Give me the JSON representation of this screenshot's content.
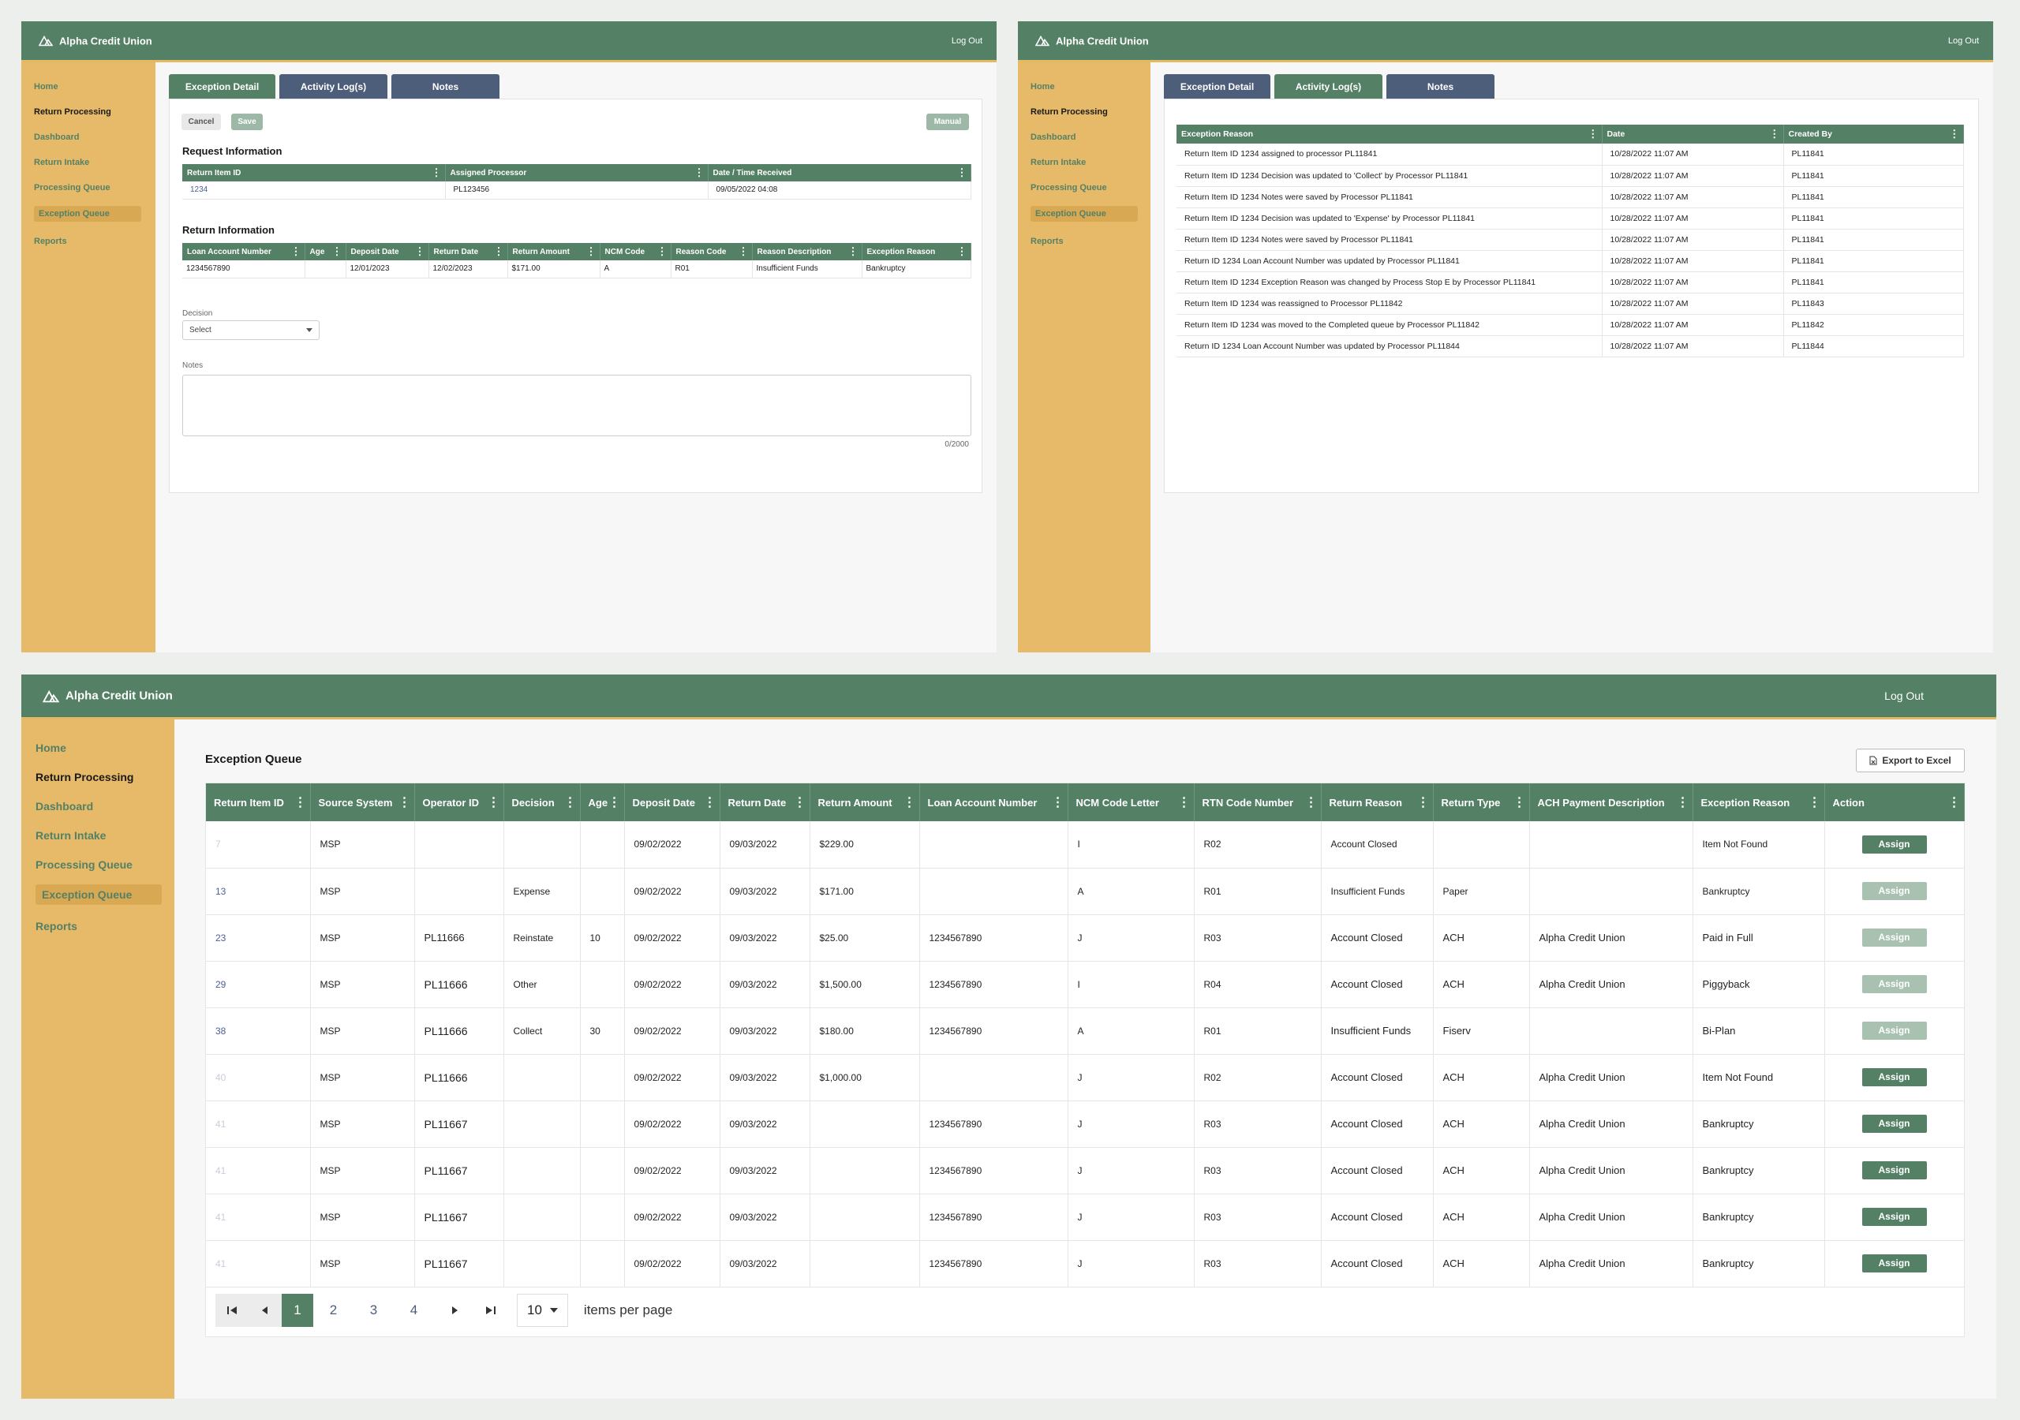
{
  "app": {
    "brand": "Alpha Credit Union",
    "logout": "Log Out"
  },
  "nav": [
    {
      "label": "Home"
    },
    {
      "label": "Return Processing"
    },
    {
      "label": "Dashboard"
    },
    {
      "label": "Return Intake"
    },
    {
      "label": "Processing Queue"
    },
    {
      "label": "Exception Queue"
    },
    {
      "label": "Reports"
    }
  ],
  "tabs": [
    "Exception Detail",
    "Activity Log(s)",
    "Notes"
  ],
  "detail": {
    "cancel": "Cancel",
    "save": "Save",
    "manual": "Manual",
    "request_title": "Request Information",
    "request_headers": [
      "Return Item ID",
      "Assigned Processor",
      "Date / Time Received"
    ],
    "request_row": [
      "1234",
      "PL123456",
      "09/05/2022 04:08"
    ],
    "return_title": "Return Information",
    "return_headers": [
      "Loan Account Number",
      "Age",
      "Deposit Date",
      "Return Date",
      "Return Amount",
      "NCM Code",
      "Reason Code",
      "Reason Description",
      "Exception Reason"
    ],
    "return_row": [
      "1234567890",
      "",
      "12/01/2023",
      "12/02/2023",
      "$171.00",
      "A",
      "R01",
      "Insufficient Funds",
      "Bankruptcy"
    ],
    "decision_label": "Decision",
    "decision_value": "Select",
    "notes_label": "Notes",
    "notes_count": "0/2000"
  },
  "activity": {
    "headers": [
      "Exception Reason",
      "Date",
      "Created By"
    ],
    "rows": [
      [
        "Return Item ID 1234 assigned to processor PL11841",
        "10/28/2022 11:07 AM",
        "PL11841"
      ],
      [
        "Return Item ID 1234 Decision was updated to 'Collect' by Processor PL11841",
        "10/28/2022 11:07 AM",
        "PL11841"
      ],
      [
        "Return Item ID 1234 Notes were saved by Processor PL11841",
        "10/28/2022 11:07 AM",
        "PL11841"
      ],
      [
        "Return Item ID 1234 Decision was updated to 'Expense' by Processor PL11841",
        "10/28/2022 11:07 AM",
        "PL11841"
      ],
      [
        "Return Item ID 1234 Notes were saved by Processor PL11841",
        "10/28/2022 11:07 AM",
        "PL11841"
      ],
      [
        "Return ID 1234 Loan Account Number was updated by Processor PL11841",
        "10/28/2022 11:07 AM",
        "PL11841"
      ],
      [
        "Return Item ID 1234 Exception Reason was changed by Process Stop E by Processor PL11841",
        "10/28/2022 11:07 AM",
        "PL11841"
      ],
      [
        "Return Item ID 1234 was reassigned to Processor PL11842",
        "10/28/2022 11:07 AM",
        "PL11843"
      ],
      [
        "Return Item ID 1234 was moved to the Completed queue by Processor PL11842",
        "10/28/2022 11:07 AM",
        "PL11842"
      ],
      [
        "Return ID 1234 Loan Account Number was updated by Processor PL11844",
        "10/28/2022 11:07 AM",
        "PL11844"
      ]
    ]
  },
  "queue": {
    "title": "Exception Queue",
    "export": "Export to Excel",
    "headers": [
      "Return Item ID",
      "Source System",
      "Operator ID",
      "Decision",
      "Age",
      "Deposit Date",
      "Return Date",
      "Return Amount",
      "Loan Account Number",
      "NCM Code Letter",
      "RTN Code Number",
      "Return Reason",
      "Return Type",
      "ACH Payment Description",
      "Exception Reason",
      "Action"
    ],
    "rows": [
      [
        "7",
        "MSP",
        "",
        "",
        "",
        "09/02/2022",
        "09/03/2022",
        "$229.00",
        "",
        "I",
        "R02",
        "Account Closed",
        "",
        "",
        "Item Not Found",
        "Assign"
      ],
      [
        "13",
        "MSP",
        "",
        "Expense",
        "",
        "09/02/2022",
        "09/03/2022",
        "$171.00",
        "",
        "A",
        "R01",
        "Insufficient Funds",
        "Paper",
        "",
        "Bankruptcy",
        "Assign"
      ],
      [
        "23",
        "MSP",
        "PL11666",
        "Reinstate",
        "10",
        "09/02/2022",
        "09/03/2022",
        "$25.00",
        "1234567890",
        "J",
        "R03",
        "Account Closed",
        "ACH",
        "Alpha Credit Union",
        "Paid in Full",
        "Assign"
      ],
      [
        "29",
        "MSP",
        "PL11666",
        "Other",
        "",
        "09/02/2022",
        "09/03/2022",
        "$1,500.00",
        "1234567890",
        "I",
        "R04",
        "Account Closed",
        "ACH",
        "Alpha Credit Union",
        "Piggyback",
        "Assign"
      ],
      [
        "38",
        "MSP",
        "PL11666",
        "Collect",
        "30",
        "09/02/2022",
        "09/03/2022",
        "$180.00",
        "1234567890",
        "A",
        "R01",
        "Insufficient Funds",
        "Fiserv",
        "",
        "Bi-Plan",
        "Assign"
      ],
      [
        "40",
        "MSP",
        "PL11666",
        "",
        "",
        "09/02/2022",
        "09/03/2022",
        "$1,000.00",
        "",
        "J",
        "R02",
        "Account Closed",
        "ACH",
        "Alpha Credit Union",
        "Item Not Found",
        "Assign"
      ],
      [
        "41",
        "MSP",
        "PL11667",
        "",
        "",
        "09/02/2022",
        "09/03/2022",
        "",
        "1234567890",
        "J",
        "R03",
        "Account Closed",
        "ACH",
        "Alpha Credit Union",
        "Bankruptcy",
        "Assign"
      ],
      [
        "41",
        "MSP",
        "PL11667",
        "",
        "",
        "09/02/2022",
        "09/03/2022",
        "",
        "1234567890",
        "J",
        "R03",
        "Account Closed",
        "ACH",
        "Alpha Credit Union",
        "Bankruptcy",
        "Assign"
      ],
      [
        "41",
        "MSP",
        "PL11667",
        "",
        "",
        "09/02/2022",
        "09/03/2022",
        "",
        "1234567890",
        "J",
        "R03",
        "Account Closed",
        "ACH",
        "Alpha Credit Union",
        "Bankruptcy",
        "Assign"
      ],
      [
        "41",
        "MSP",
        "PL11667",
        "",
        "",
        "09/02/2022",
        "09/03/2022",
        "",
        "1234567890",
        "J",
        "R03",
        "Account Closed",
        "ACH",
        "Alpha Credit Union",
        "Bankruptcy",
        "Assign"
      ]
    ],
    "link_rows": [
      false,
      true,
      true,
      true,
      true,
      false,
      false,
      false,
      false,
      false
    ],
    "assign_enabled": [
      true,
      false,
      false,
      false,
      false,
      true,
      true,
      true,
      true,
      true
    ],
    "pages": [
      "1",
      "2",
      "3",
      "4"
    ],
    "current_page": "1",
    "page_size": "10",
    "per_page_label": "items per page"
  },
  "colors": {
    "header": "#548066",
    "sidebar": "#e6ba68",
    "accent": "#e3ba62",
    "tab_inactive": "#4c5e7a"
  },
  "icons": [
    "logo-mountain-icon",
    "kebab-menu-icon",
    "chevron-down-icon",
    "first-page-icon",
    "prev-page-icon",
    "next-page-icon",
    "last-page-icon",
    "excel-file-icon"
  ]
}
